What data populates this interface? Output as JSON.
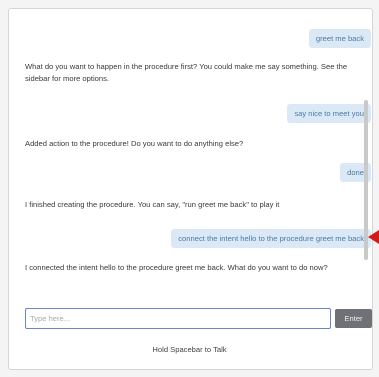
{
  "chat": {
    "messages": [
      {
        "role": "user",
        "text": "greet me back"
      },
      {
        "role": "bot",
        "text": "What do you want to happen in the procedure first? You could make me say something. See the sidebar for more options."
      },
      {
        "role": "user",
        "text": "say nice to meet you"
      },
      {
        "role": "bot",
        "text": "Added action to the procedure! Do you want to do anything else?"
      },
      {
        "role": "user",
        "text": "done"
      },
      {
        "role": "bot",
        "text": "I finished creating the procedure. You can say, \"run greet me back\" to play it"
      },
      {
        "role": "user",
        "text": "connect the intent hello to the procedure greet me back"
      },
      {
        "role": "bot",
        "text": "I connected the intent hello to the procedure greet me back. What do you want to do now?"
      }
    ]
  },
  "input": {
    "placeholder": "Type here...",
    "value": ""
  },
  "enter_label": "Enter",
  "hold_hint": "Hold Spacebar to Talk",
  "colors": {
    "user_bubble": "#dbe9f6",
    "user_text": "#4e7aa5",
    "enter_button": "#6e7276",
    "pointer_marker": "#d31a1a"
  }
}
